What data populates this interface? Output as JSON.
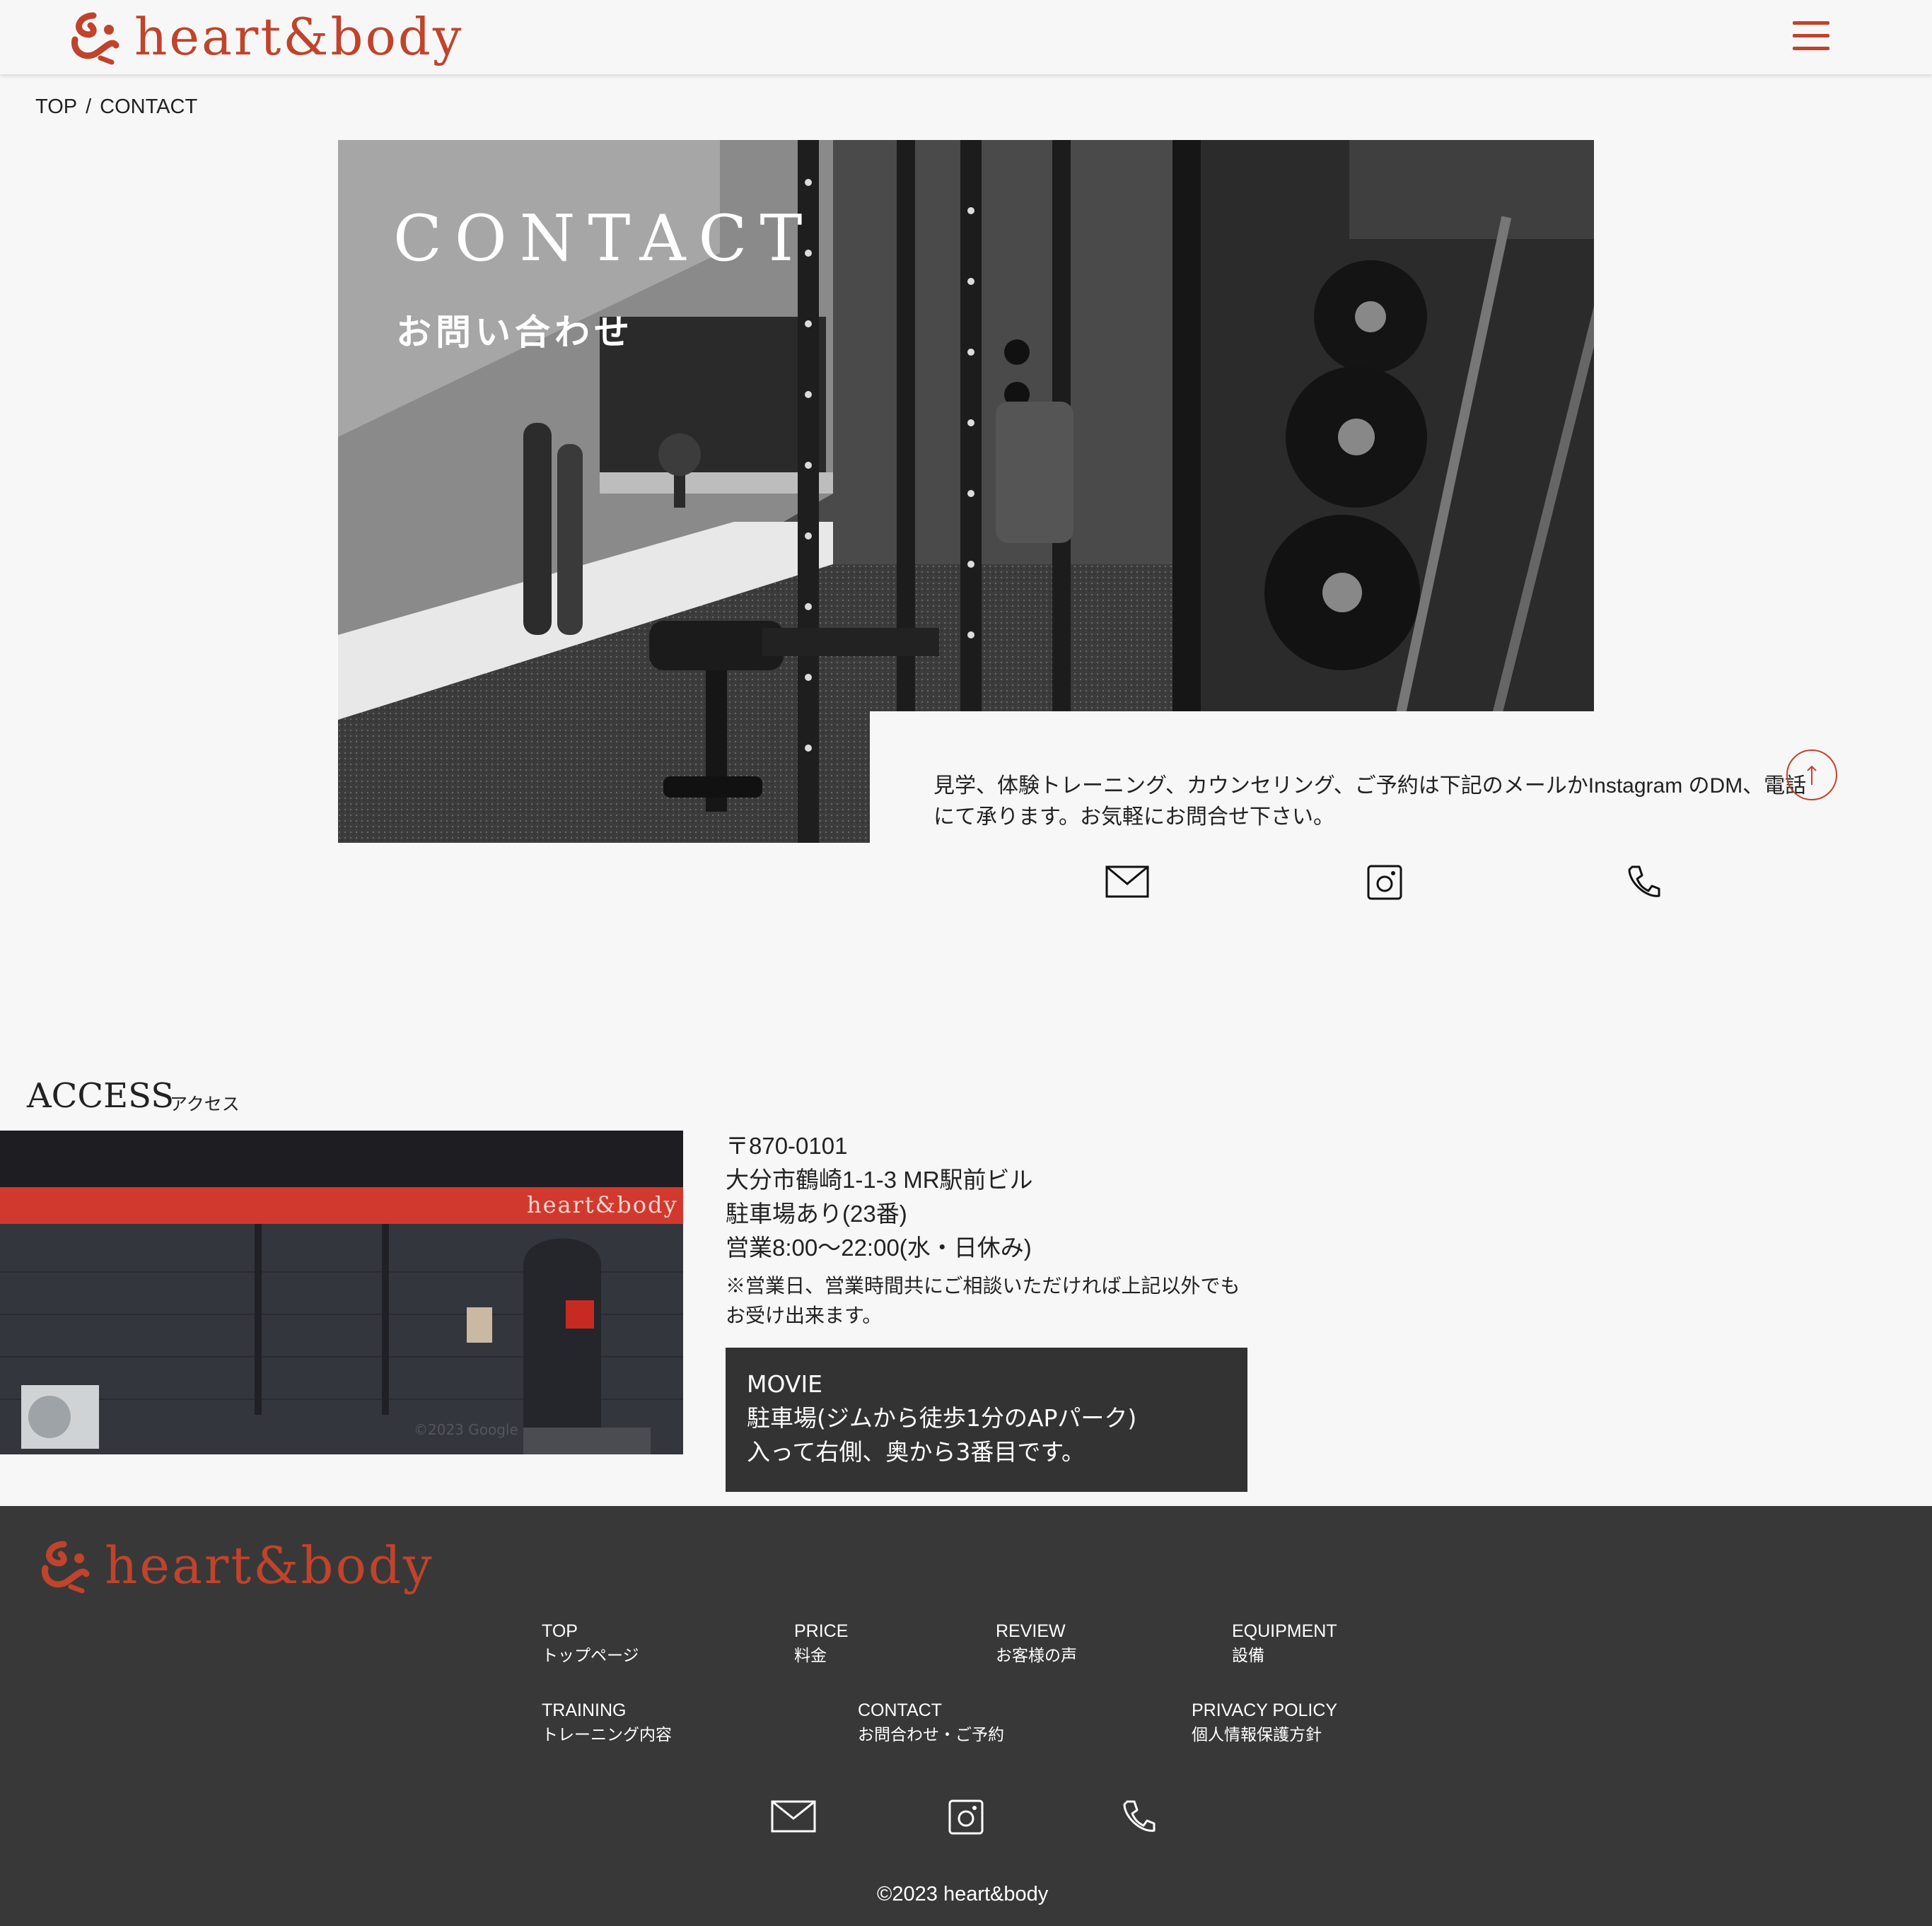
{
  "brand": {
    "name": "heart&body",
    "accent_color": "#c0432b",
    "footer_bg": "#383838"
  },
  "header": {
    "menu_icon": "hamburger-menu-icon"
  },
  "breadcrumb": {
    "home": "TOP",
    "separator": "/",
    "current": "CONTACT"
  },
  "hero": {
    "title": "CONTACT",
    "subtitle": "お問い合わせ"
  },
  "contact": {
    "intro_line1": "見学、体験トレーニング、カウンセリング、ご予約は下記のメールかInstagram のDM、電話",
    "intro_line2": "にて承ります。お気軽にお問合せ下さい。",
    "icons": [
      "mail-icon",
      "instagram-icon",
      "phone-icon"
    ]
  },
  "access": {
    "title": "ACCESS",
    "subtitle": "アクセス",
    "storefront_sign": "heart&body",
    "watermark": "©2023 Google",
    "postal": "〒870-0101",
    "address": "大分市鶴崎1-1-3 MR駅前ビル",
    "parking": "駐車場あり(23番)",
    "hours": "営業8:00～22:00(水・日休み)",
    "note_line1": "※営業日、営業時間共にご相談いただければ上記以外でも",
    "note_line2": "お受け出来ます。",
    "movie": {
      "label": "MOVIE",
      "line1": "駐車場(ジムから徒歩1分のAPパーク)",
      "line2": "入って右側、奥から3番目です。"
    }
  },
  "footer": {
    "nav": [
      {
        "en": "TOP",
        "ja": "トップページ"
      },
      {
        "en": "PRICE",
        "ja": "料金"
      },
      {
        "en": "REVIEW",
        "ja": "お客様の声"
      },
      {
        "en": "EQUIPMENT",
        "ja": "設備"
      },
      {
        "en": "TRAINING",
        "ja": "トレーニング内容"
      },
      {
        "en": "CONTACT",
        "ja": "お問合わせ・ご予約"
      },
      {
        "en": "PRIVACY POLICY",
        "ja": "個人情報保護方針"
      }
    ],
    "copyright": "©2023 heart&body"
  }
}
